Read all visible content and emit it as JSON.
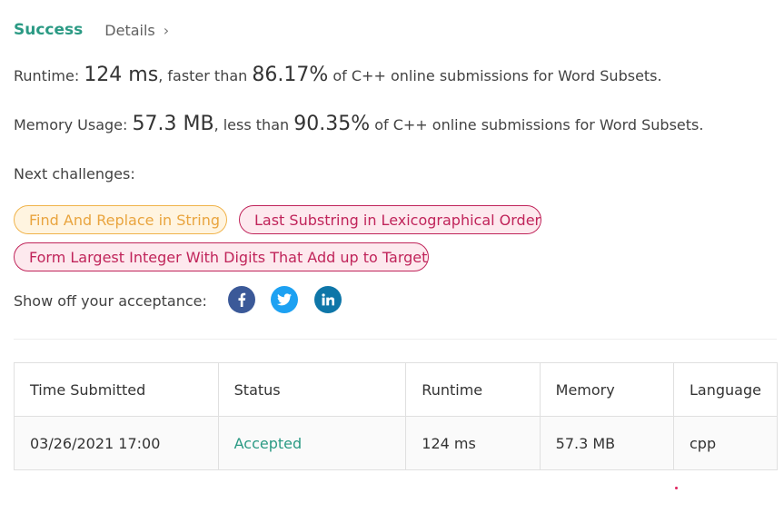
{
  "header": {
    "status": "Success",
    "details_label": "Details",
    "details_chevron": "›"
  },
  "runtime": {
    "label": "Runtime:",
    "value": "124 ms",
    "comparison": ", faster than",
    "percent": "86.17%",
    "suffix": "of C++ online submissions for Word Subsets."
  },
  "memory": {
    "label": "Memory Usage:",
    "value": "57.3 MB",
    "comparison": ", less than",
    "percent": "90.35%",
    "suffix": "of C++ online submissions for Word Subsets."
  },
  "next_challenges": {
    "label": "Next challenges:",
    "items": [
      {
        "title": "Find And Replace in String",
        "difficulty": "medium"
      },
      {
        "title": "Last Substring in Lexicographical Order",
        "difficulty": "hard"
      },
      {
        "title": "Form Largest Integer With Digits That Add up to Target",
        "difficulty": "hard"
      }
    ]
  },
  "share": {
    "label": "Show off your acceptance:",
    "icons": [
      "facebook-icon",
      "twitter-icon",
      "linkedin-icon"
    ]
  },
  "table": {
    "headers": [
      "Time Submitted",
      "Status",
      "Runtime",
      "Memory",
      "Language"
    ],
    "rows": [
      {
        "time": "03/26/2021 17:00",
        "status": "Accepted",
        "runtime": "124 ms",
        "memory": "57.3 MB",
        "language": "cpp"
      }
    ]
  },
  "colors": {
    "accent_green": "#2b9a84",
    "medium_tag": "#e9a43e",
    "hard_tag": "#c0245a",
    "facebook": "#3b5998",
    "twitter": "#1da1f2",
    "linkedin": "#0e76a8"
  }
}
